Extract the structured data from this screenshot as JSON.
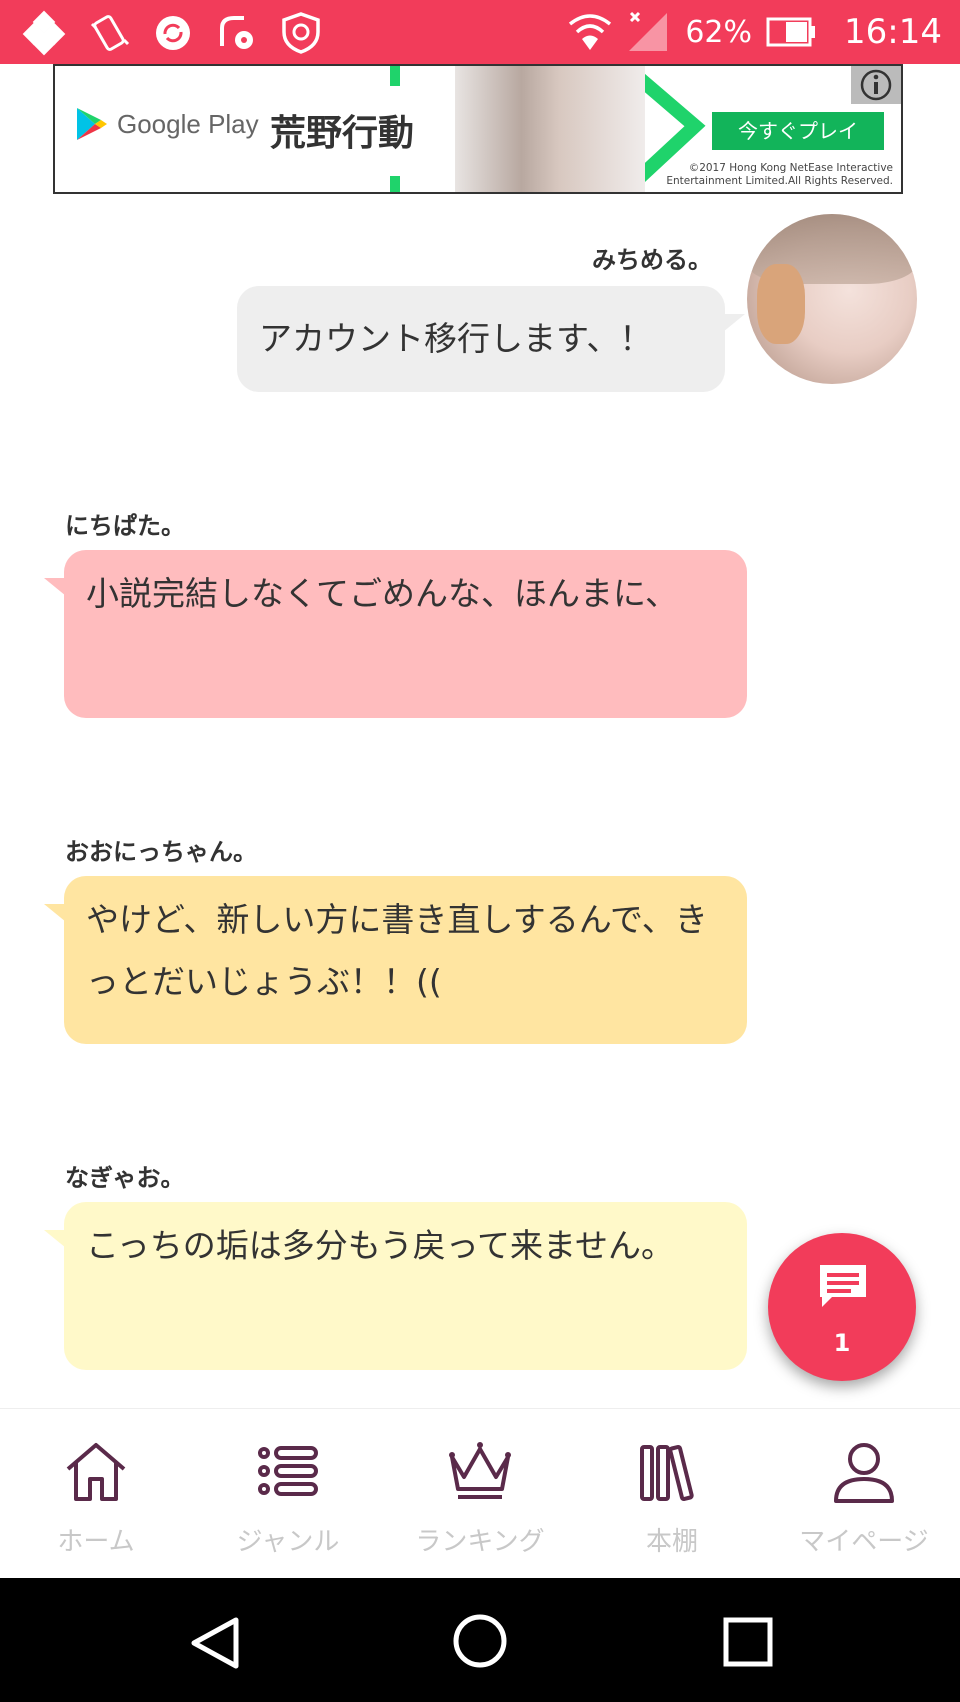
{
  "status_bar": {
    "battery": "62%",
    "time": "16:14",
    "icons": [
      "app-icon",
      "vibrate-icon",
      "sync-icon",
      "settings-icon",
      "shield-icon",
      "wifi-icon",
      "signal-icon",
      "battery-icon"
    ]
  },
  "ad": {
    "store": "Google Play",
    "game_title": "荒野行動",
    "cta": "今すぐプレイ",
    "copyright_line1": "©2017 Hong Kong NetEase Interactive",
    "copyright_line2": "Entertainment Limited.All Rights Reserved."
  },
  "messages": [
    {
      "author": "みちめる。",
      "text": "アカウント移行します、！",
      "side": "right",
      "color": "#eeeeee"
    },
    {
      "author": "にちぱた。",
      "text": "小説完結しなくてごめんな、ほんまに、",
      "side": "left",
      "color": "#ffbcbe"
    },
    {
      "author": "おおにっちゃん。",
      "text": "やけど、新しい方に書き直しするんで、きっとだいじょうぶ！！((",
      "side": "left",
      "color": "#ffe5a1"
    },
    {
      "author": "なぎゃお。",
      "text": "こっちの垢は多分もう戻って来ません。",
      "side": "left",
      "color": "#fff9c9"
    }
  ],
  "fab": {
    "count": "1",
    "icon": "chat-icon"
  },
  "bottom_nav": [
    {
      "label": "ホーム",
      "icon": "home-icon"
    },
    {
      "label": "ジャンル",
      "icon": "list-icon"
    },
    {
      "label": "ランキング",
      "icon": "crown-icon"
    },
    {
      "label": "本棚",
      "icon": "bookshelf-icon"
    },
    {
      "label": "マイページ",
      "icon": "user-icon"
    }
  ],
  "colors": {
    "accent": "#f23c5a",
    "nav_label": "#c8c8c8",
    "icon": "#5a2a4a"
  }
}
